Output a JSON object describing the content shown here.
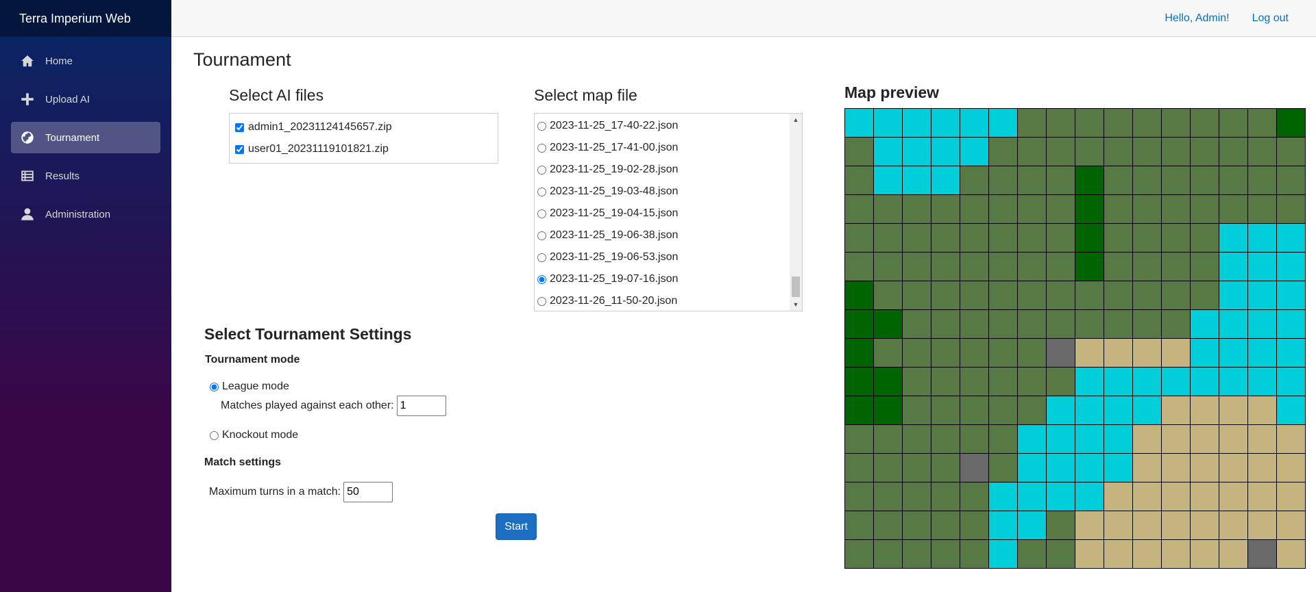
{
  "app": {
    "brand": "Terra Imperium Web"
  },
  "nav": [
    {
      "label": "Home",
      "icon": "home-icon",
      "active": false
    },
    {
      "label": "Upload AI",
      "icon": "plus-icon",
      "active": false
    },
    {
      "label": "Tournament",
      "icon": "globe-icon",
      "active": true
    },
    {
      "label": "Results",
      "icon": "list-icon",
      "active": false
    },
    {
      "label": "Administration",
      "icon": "person-icon",
      "active": false
    }
  ],
  "topbar": {
    "greeting": "Hello, Admin!",
    "logout": "Log out"
  },
  "page": {
    "title": "Tournament"
  },
  "ai_files": {
    "heading": "Select AI files",
    "items": [
      {
        "label": "admin1_20231124145657.zip",
        "checked": true
      },
      {
        "label": "user01_20231119101821.zip",
        "checked": true
      }
    ]
  },
  "map_files": {
    "heading": "Select map file",
    "items": [
      {
        "label": "2023-11-25_17-40-22.json",
        "selected": false
      },
      {
        "label": "2023-11-25_17-41-00.json",
        "selected": false
      },
      {
        "label": "2023-11-25_19-02-28.json",
        "selected": false
      },
      {
        "label": "2023-11-25_19-03-48.json",
        "selected": false
      },
      {
        "label": "2023-11-25_19-04-15.json",
        "selected": false
      },
      {
        "label": "2023-11-25_19-06-38.json",
        "selected": false
      },
      {
        "label": "2023-11-25_19-06-53.json",
        "selected": false
      },
      {
        "label": "2023-11-25_19-07-16.json",
        "selected": true
      },
      {
        "label": "2023-11-26_11-50-20.json",
        "selected": false
      }
    ]
  },
  "settings": {
    "heading": "Select Tournament Settings",
    "mode_label": "Tournament mode",
    "league_label": "League mode",
    "league_selected": true,
    "matches_label": "Matches played against each other:",
    "matches_value": "1",
    "knockout_label": "Knockout mode",
    "knockout_selected": false,
    "match_settings_label": "Match settings",
    "max_turns_label": "Maximum turns in a match:",
    "max_turns_value": "50",
    "start_label": "Start"
  },
  "preview": {
    "heading": "Map preview",
    "colors": {
      "W": "#00ced8",
      "G": "#577a44",
      "D": "#006400",
      "S": "#c5b380",
      "R": "#696969"
    },
    "grid": [
      "WWWWWWGGGGGGGGGD",
      "GWWWWGGGGGGGGGGG",
      "GWWWGGGGDGGGGGGG",
      "GGGGGGGGDGGGGGGG",
      "GGGGGGGGDGGGGWWW",
      "GGGGGGGGDGGGGWWW",
      "DGGGGGGGGGGGGWWW",
      "DDGGGGGGGGGGWWWW",
      "DGGGGGGRSSSSWWWW",
      "DDGGGGGGWWWWWWWW",
      "DDGGGGGWWWWSSSSW",
      "GGGGGGWWWWSSSSSS",
      "GGGGRGWWWWSSSSSS",
      "GGGGGWWWWSSSSSSS",
      "GGGGGWWGSSSSSSSS",
      "GGGGGWGGSSSSSSRS"
    ]
  }
}
